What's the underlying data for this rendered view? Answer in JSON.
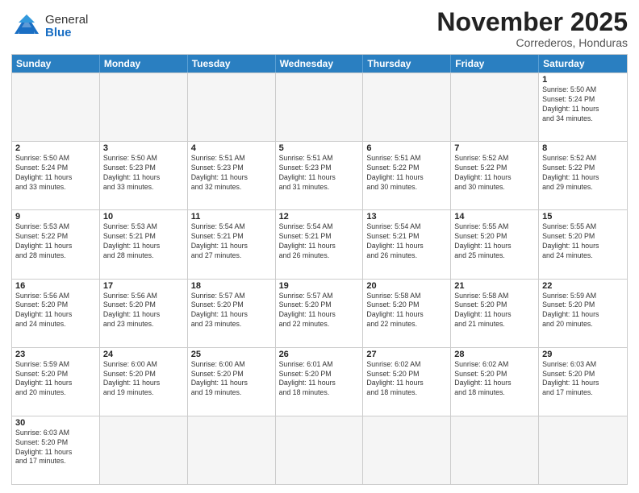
{
  "header": {
    "logo_general": "General",
    "logo_blue": "Blue",
    "month_title": "November 2025",
    "location": "Correderos, Honduras"
  },
  "weekdays": [
    "Sunday",
    "Monday",
    "Tuesday",
    "Wednesday",
    "Thursday",
    "Friday",
    "Saturday"
  ],
  "weeks": [
    [
      {
        "day": "",
        "info": ""
      },
      {
        "day": "",
        "info": ""
      },
      {
        "day": "",
        "info": ""
      },
      {
        "day": "",
        "info": ""
      },
      {
        "day": "",
        "info": ""
      },
      {
        "day": "",
        "info": ""
      },
      {
        "day": "1",
        "info": "Sunrise: 5:50 AM\nSunset: 5:24 PM\nDaylight: 11 hours\nand 34 minutes."
      }
    ],
    [
      {
        "day": "2",
        "info": "Sunrise: 5:50 AM\nSunset: 5:24 PM\nDaylight: 11 hours\nand 33 minutes."
      },
      {
        "day": "3",
        "info": "Sunrise: 5:50 AM\nSunset: 5:23 PM\nDaylight: 11 hours\nand 33 minutes."
      },
      {
        "day": "4",
        "info": "Sunrise: 5:51 AM\nSunset: 5:23 PM\nDaylight: 11 hours\nand 32 minutes."
      },
      {
        "day": "5",
        "info": "Sunrise: 5:51 AM\nSunset: 5:23 PM\nDaylight: 11 hours\nand 31 minutes."
      },
      {
        "day": "6",
        "info": "Sunrise: 5:51 AM\nSunset: 5:22 PM\nDaylight: 11 hours\nand 30 minutes."
      },
      {
        "day": "7",
        "info": "Sunrise: 5:52 AM\nSunset: 5:22 PM\nDaylight: 11 hours\nand 30 minutes."
      },
      {
        "day": "8",
        "info": "Sunrise: 5:52 AM\nSunset: 5:22 PM\nDaylight: 11 hours\nand 29 minutes."
      }
    ],
    [
      {
        "day": "9",
        "info": "Sunrise: 5:53 AM\nSunset: 5:22 PM\nDaylight: 11 hours\nand 28 minutes."
      },
      {
        "day": "10",
        "info": "Sunrise: 5:53 AM\nSunset: 5:21 PM\nDaylight: 11 hours\nand 28 minutes."
      },
      {
        "day": "11",
        "info": "Sunrise: 5:54 AM\nSunset: 5:21 PM\nDaylight: 11 hours\nand 27 minutes."
      },
      {
        "day": "12",
        "info": "Sunrise: 5:54 AM\nSunset: 5:21 PM\nDaylight: 11 hours\nand 26 minutes."
      },
      {
        "day": "13",
        "info": "Sunrise: 5:54 AM\nSunset: 5:21 PM\nDaylight: 11 hours\nand 26 minutes."
      },
      {
        "day": "14",
        "info": "Sunrise: 5:55 AM\nSunset: 5:20 PM\nDaylight: 11 hours\nand 25 minutes."
      },
      {
        "day": "15",
        "info": "Sunrise: 5:55 AM\nSunset: 5:20 PM\nDaylight: 11 hours\nand 24 minutes."
      }
    ],
    [
      {
        "day": "16",
        "info": "Sunrise: 5:56 AM\nSunset: 5:20 PM\nDaylight: 11 hours\nand 24 minutes."
      },
      {
        "day": "17",
        "info": "Sunrise: 5:56 AM\nSunset: 5:20 PM\nDaylight: 11 hours\nand 23 minutes."
      },
      {
        "day": "18",
        "info": "Sunrise: 5:57 AM\nSunset: 5:20 PM\nDaylight: 11 hours\nand 23 minutes."
      },
      {
        "day": "19",
        "info": "Sunrise: 5:57 AM\nSunset: 5:20 PM\nDaylight: 11 hours\nand 22 minutes."
      },
      {
        "day": "20",
        "info": "Sunrise: 5:58 AM\nSunset: 5:20 PM\nDaylight: 11 hours\nand 22 minutes."
      },
      {
        "day": "21",
        "info": "Sunrise: 5:58 AM\nSunset: 5:20 PM\nDaylight: 11 hours\nand 21 minutes."
      },
      {
        "day": "22",
        "info": "Sunrise: 5:59 AM\nSunset: 5:20 PM\nDaylight: 11 hours\nand 20 minutes."
      }
    ],
    [
      {
        "day": "23",
        "info": "Sunrise: 5:59 AM\nSunset: 5:20 PM\nDaylight: 11 hours\nand 20 minutes."
      },
      {
        "day": "24",
        "info": "Sunrise: 6:00 AM\nSunset: 5:20 PM\nDaylight: 11 hours\nand 19 minutes."
      },
      {
        "day": "25",
        "info": "Sunrise: 6:00 AM\nSunset: 5:20 PM\nDaylight: 11 hours\nand 19 minutes."
      },
      {
        "day": "26",
        "info": "Sunrise: 6:01 AM\nSunset: 5:20 PM\nDaylight: 11 hours\nand 18 minutes."
      },
      {
        "day": "27",
        "info": "Sunrise: 6:02 AM\nSunset: 5:20 PM\nDaylight: 11 hours\nand 18 minutes."
      },
      {
        "day": "28",
        "info": "Sunrise: 6:02 AM\nSunset: 5:20 PM\nDaylight: 11 hours\nand 18 minutes."
      },
      {
        "day": "29",
        "info": "Sunrise: 6:03 AM\nSunset: 5:20 PM\nDaylight: 11 hours\nand 17 minutes."
      }
    ],
    [
      {
        "day": "30",
        "info": "Sunrise: 6:03 AM\nSunset: 5:20 PM\nDaylight: 11 hours\nand 17 minutes."
      },
      {
        "day": "",
        "info": ""
      },
      {
        "day": "",
        "info": ""
      },
      {
        "day": "",
        "info": ""
      },
      {
        "day": "",
        "info": ""
      },
      {
        "day": "",
        "info": ""
      },
      {
        "day": "",
        "info": ""
      }
    ]
  ]
}
